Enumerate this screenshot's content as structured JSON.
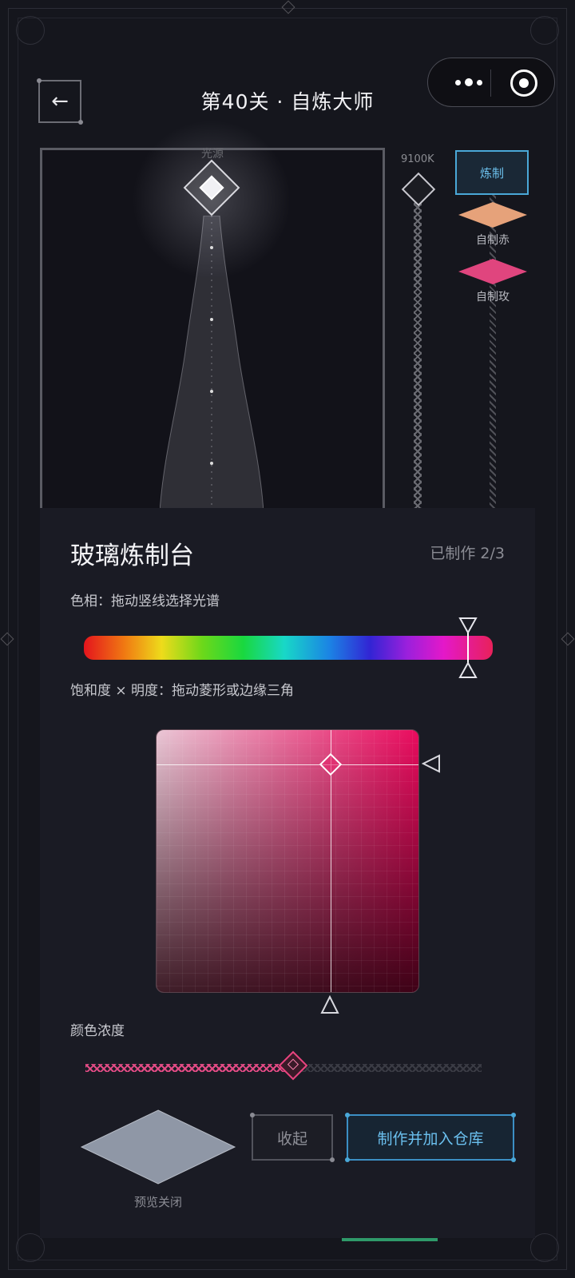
{
  "header": {
    "title": "第40关 · 自炼大师",
    "back_label": "←"
  },
  "stage": {
    "source_label": "光源",
    "rail_label": "9100K"
  },
  "side_palette": {
    "refine_button": "炼制",
    "swatches": [
      {
        "label": "自制赤",
        "color": "#e6a27a"
      },
      {
        "label": "自制玫",
        "color": "#e0457e"
      }
    ]
  },
  "panel": {
    "title": "玻璃炼制台",
    "count": "已制作 2/3",
    "hue_label": "色相：拖动竖线选择光谱",
    "hue_value": 0.94,
    "sv_label": "饱和度 × 明度：拖动菱形或边缘三角",
    "saturation": 0.66,
    "brightness": 0.87,
    "sv_color": "#e40f62",
    "intensity_label": "颜色浓度",
    "intensity": 0.52,
    "preview_label": "预览关闭",
    "collapse_button": "收起",
    "make_button": "制作并加入仓库"
  },
  "colors": {
    "accent_blue": "#4aa8d8",
    "accent_pink": "#e2457e",
    "preview_gray": "#8f97a6"
  }
}
